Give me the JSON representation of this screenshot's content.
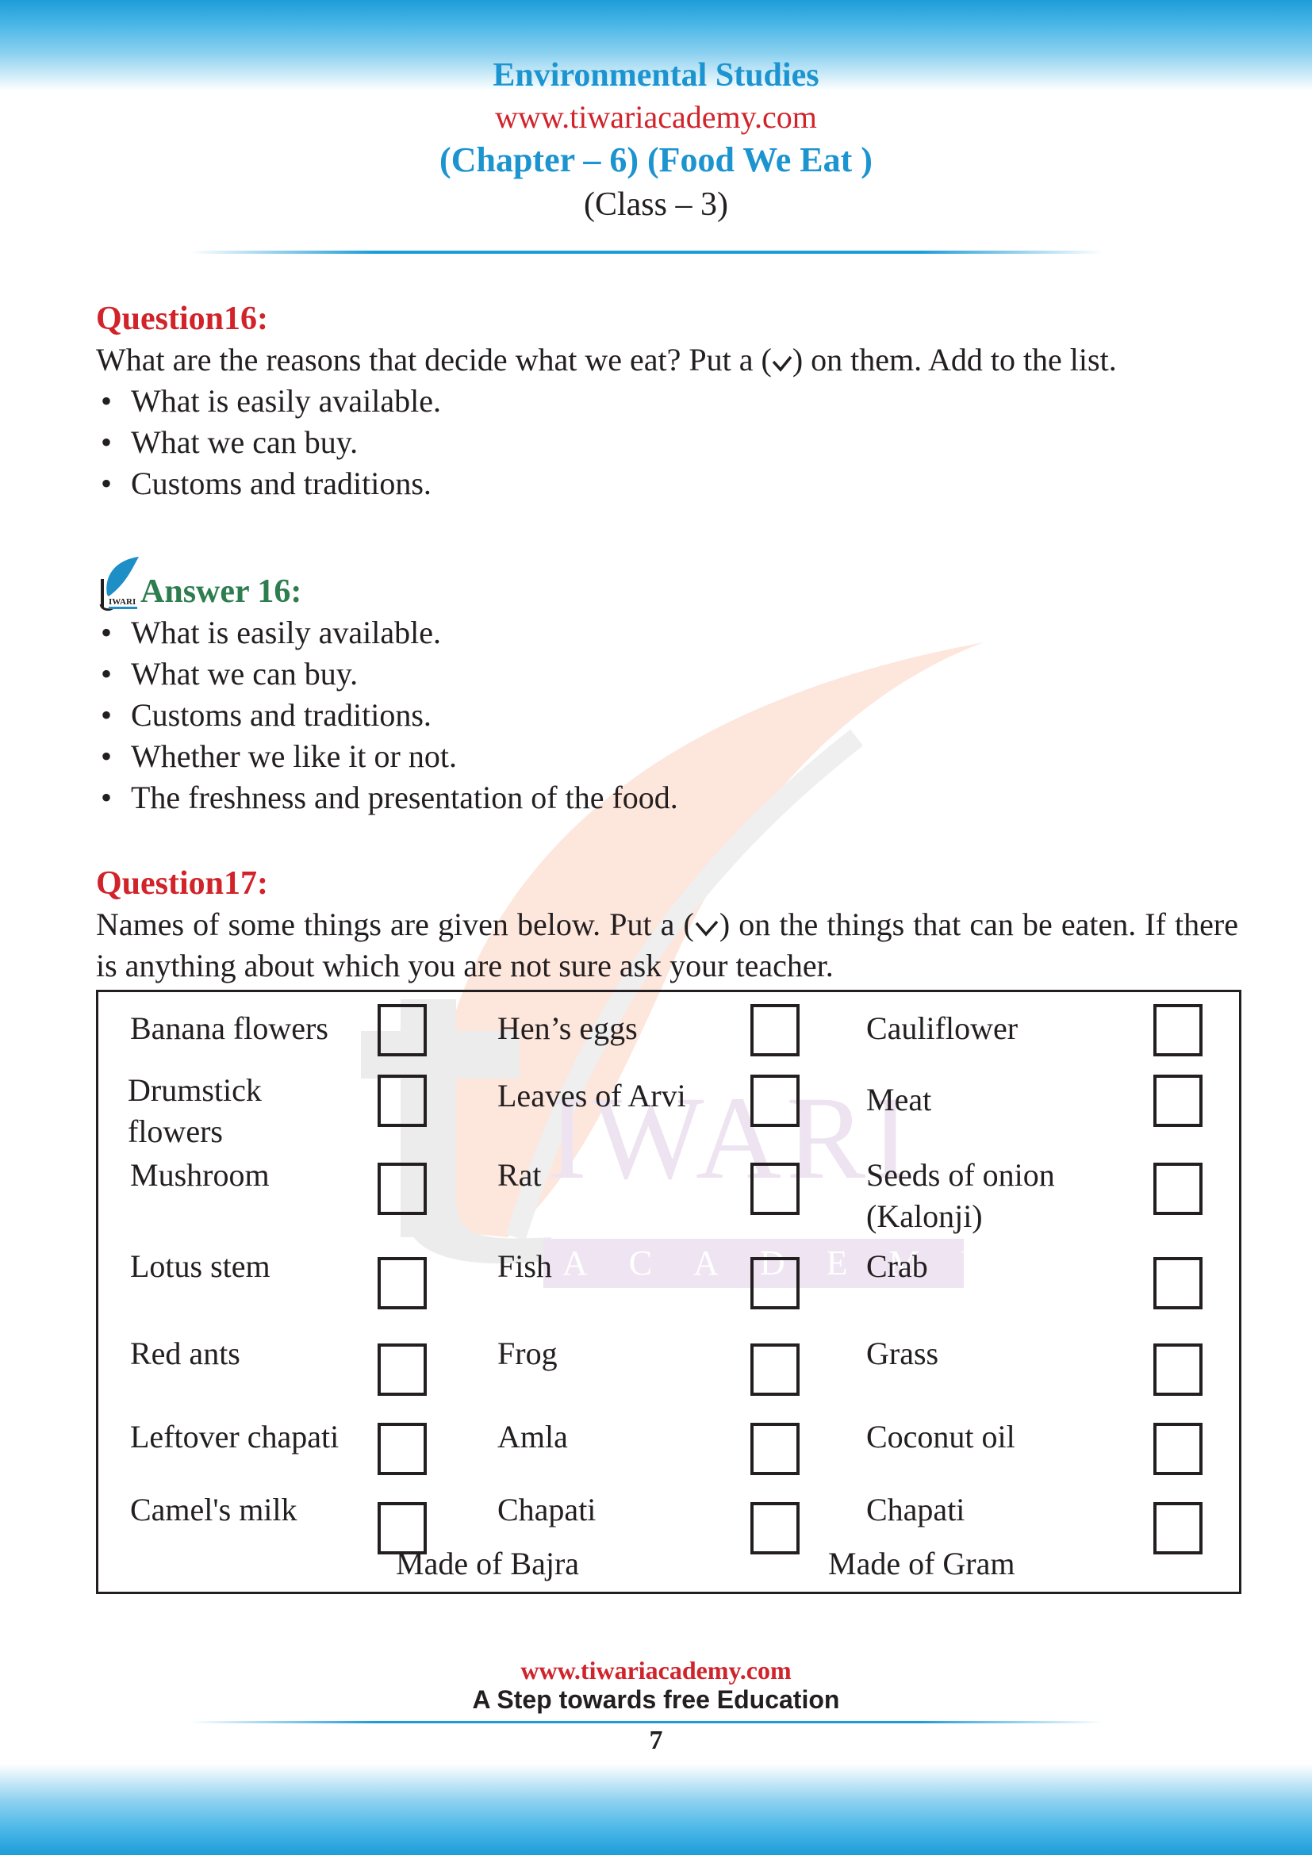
{
  "header": {
    "subject": "Environmental Studies",
    "website": "www.tiwariacademy.com",
    "chapter": "(Chapter – 6) (Food We Eat )",
    "class": "(Class – 3)"
  },
  "colors": {
    "brand_blue": "#1b94cf",
    "question_red": "#d1232a",
    "answer_green": "#2e7d4f",
    "text": "#231f20"
  },
  "question16": {
    "title": "Question16:",
    "text_before_tick": "What are the reasons that decide what we eat? Put a (",
    "tick_icon": "check-mark-icon",
    "text_after_tick": ") on them. Add to the list.",
    "items": [
      "What is easily available.",
      "What we can buy.",
      "Customs and traditions."
    ]
  },
  "answer16": {
    "logo_icon": "tiwari-logo-icon",
    "logo_text": "IWARI",
    "title": "Answer 16:",
    "items": [
      "What is easily available.",
      "What we can buy.",
      "Customs and traditions.",
      "Whether we like it or not.",
      "The freshness and presentation of the food."
    ]
  },
  "question17": {
    "title": "Question17:",
    "text_before_tick": "Names of some things are given below. Put a (",
    "tick_icon": "check-mark-icon",
    "text_after_tick": ") on the things that can be eaten. If there is anything about which you are not sure ask your teacher.",
    "rows": [
      [
        {
          "label": "Banana flowers",
          "checked": false
        },
        {
          "label": "Hen’s eggs",
          "checked": false
        },
        {
          "label": "Cauliflower",
          "checked": false
        }
      ],
      [
        {
          "label": "Drumstick flowers",
          "checked": false
        },
        {
          "label": "Leaves of Arvi",
          "checked": false
        },
        {
          "label": "Meat",
          "checked": false
        }
      ],
      [
        {
          "label": "Mushroom",
          "checked": false
        },
        {
          "label": "Rat",
          "checked": false
        },
        {
          "label": "Seeds of onion (Kalonji)",
          "checked": false
        }
      ],
      [
        {
          "label": "Lotus stem",
          "checked": false
        },
        {
          "label": "Fish",
          "checked": false
        },
        {
          "label": "Crab",
          "checked": false
        }
      ],
      [
        {
          "label": "Red ants",
          "checked": false
        },
        {
          "label": "Frog",
          "checked": false
        },
        {
          "label": "Grass",
          "checked": false
        }
      ],
      [
        {
          "label": "Leftover chapati",
          "checked": false
        },
        {
          "label": "Amla",
          "checked": false
        },
        {
          "label": "Coconut oil",
          "checked": false
        }
      ],
      [
        {
          "label": "Camel's milk",
          "checked": false
        },
        {
          "label": "Chapati",
          "checked": false
        },
        {
          "label": "Chapati",
          "checked": false
        }
      ]
    ],
    "notes": [
      "Made of Bajra",
      "Made of Gram"
    ]
  },
  "watermark": {
    "text_main": "IWARI",
    "text_sub": "ACADEMY"
  },
  "footer": {
    "website": "www.tiwariacademy.com",
    "tagline": "A Step towards free Education",
    "page_number": "7"
  }
}
